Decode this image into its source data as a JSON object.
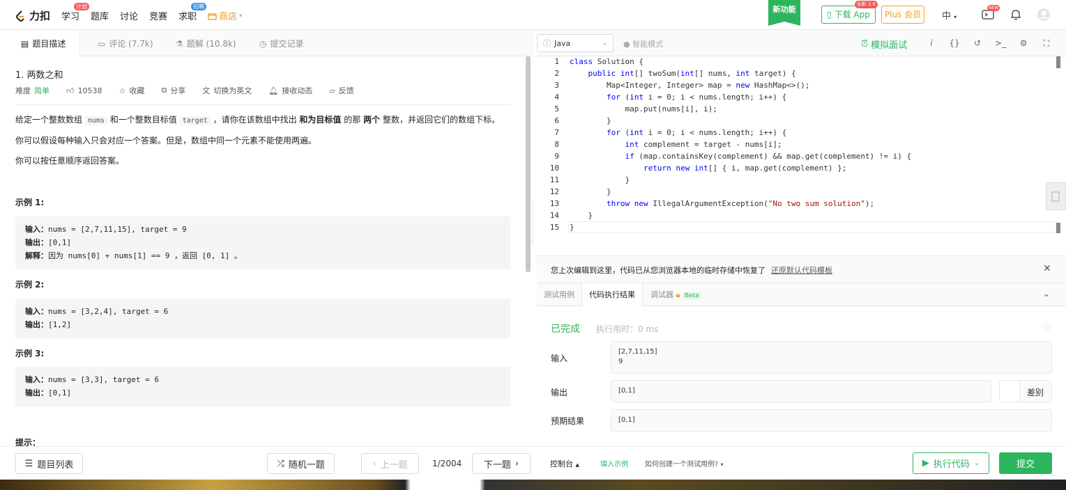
{
  "nav": {
    "logo_text": "力扣",
    "links": [
      {
        "label": "学习",
        "tag": "计划",
        "tag_color": "#f35a5a"
      },
      {
        "label": "题库"
      },
      {
        "label": "讨论"
      },
      {
        "label": "竞赛"
      },
      {
        "label": "求职",
        "tag": "招聘",
        "tag_color": "#3a8ee6"
      }
    ],
    "shop_label": "商店",
    "new_feature": "新功能",
    "download_app": "下载 App",
    "download_tag": "全新 2.0",
    "plus": "Plus 会员",
    "lang": "中",
    "new_badge": "NEW",
    "accent": "#2db55d"
  },
  "left_tabs": {
    "description": "题目描述",
    "comments": "评论 (7.7k)",
    "solutions": "题解 (10.8k)",
    "submissions": "提交记录"
  },
  "problem": {
    "title": "1. 两数之和",
    "difficulty_label": "难度",
    "difficulty": "简单",
    "likes": "10538",
    "favorite": "收藏",
    "share": "分享",
    "switch_lang": "切换为英文",
    "subscribe": "接收动态",
    "feedback": "反馈",
    "desc_1": "给定一个整数数组",
    "desc_nums": "nums",
    "desc_2": "和一个整数目标值",
    "desc_target": "target",
    "desc_3": "，请你在该数组中找出",
    "desc_bold1": "和为目标值",
    "desc_4": "的那",
    "desc_bold2": "两个",
    "desc_5": "整数，并返回它们的数组下标。",
    "para2": "你可以假设每种输入只会对应一个答案。但是，数组中同一个元素不能使用两遍。",
    "para3": "你可以按任意顺序返回答案。",
    "examples": [
      {
        "label": "示例 1:",
        "input_label": "输入：",
        "input": "nums = [2,7,11,15], target = 9",
        "output_label": "输出：",
        "output": "[0,1]",
        "explain_label": "解释：",
        "explain": "因为 nums[0] + nums[1] == 9 ，返回 [0, 1] 。"
      },
      {
        "label": "示例 2:",
        "input_label": "输入：",
        "input": "nums = [3,2,4], target = 6",
        "output_label": "输出：",
        "output": "[1,2]"
      },
      {
        "label": "示例 3:",
        "input_label": "输入：",
        "input": "nums = [3,3], target = 6",
        "output_label": "输出：",
        "output": "[0,1]"
      }
    ],
    "hint_label": "提示："
  },
  "bottom": {
    "problem_list": "题目列表",
    "random": "随机一题",
    "prev": "上一题",
    "page": "1/2004",
    "next": "下一题",
    "console": "控制台",
    "fill_example": "填入示例",
    "howto": "如何创建一个测试用例?",
    "run": "执行代码",
    "submit": "提交"
  },
  "editor": {
    "language": "Java",
    "smart_mode": "智能模式",
    "mock_interview": "模拟面试",
    "lines": [
      "class Solution {",
      "    public int[] twoSum(int[] nums, int target) {",
      "        Map<Integer, Integer> map = new HashMap<>();",
      "        for (int i = 0; i < nums.length; i++) {",
      "            map.put(nums[i], i);",
      "        }",
      "        for (int i = 0; i < nums.length; i++) {",
      "            int complement = target - nums[i];",
      "            if (map.containsKey(complement) && map.get(complement) != i) {",
      "                return new int[] { i, map.get(complement) };",
      "            }",
      "        }",
      "        throw new IllegalArgumentException(\"No two sum solution\");",
      "    }",
      "}"
    ]
  },
  "restore": {
    "message": "您上次编辑到这里，代码已从您浏览器本地的临时存储中恢复了",
    "link": "还原默认代码模板"
  },
  "result_tabs": {
    "testcase": "测试用例",
    "result": "代码执行结果",
    "debugger": "调试器",
    "beta": "Beta"
  },
  "result": {
    "status": "已完成",
    "runtime": "执行用时：0 ms",
    "input_label": "输入",
    "input_value": "[2,7,11,15]\n9",
    "output_label": "输出",
    "output_value": "[0,1]",
    "diff": "差别",
    "expected_label": "预期结果",
    "expected_value": "[0,1]"
  }
}
